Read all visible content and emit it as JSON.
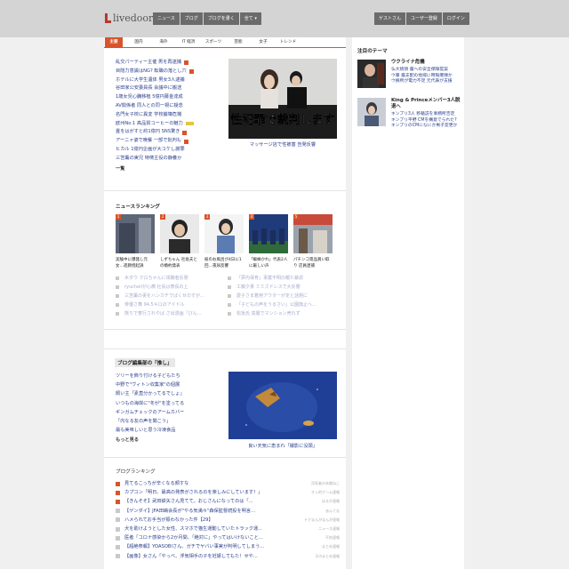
{
  "header": {
    "logo_text": "livedoor",
    "nav": [
      "ニュース",
      "ブログ",
      "ブログを書く",
      "全て ▾"
    ],
    "right": [
      "ゲストさん",
      "ユーザー登録",
      "ログイン"
    ]
  },
  "categories": [
    "主要",
    "国内",
    "海外",
    "IT 経済",
    "スポーツ",
    "芸能",
    "女子",
    "トレンド"
  ],
  "headlines": [
    {
      "text": "乱交パーティー主催 男を再逮捕",
      "badge": "new"
    },
    {
      "text": "目隠力意識はNG? 転職の落とし穴",
      "badge": "new"
    },
    {
      "text": "ホテルに大学生遺体 男女3人逮捕",
      "badge": ""
    },
    {
      "text": "谷田家公安委員長 会議中に搬送",
      "badge": ""
    },
    {
      "text": "1歳女児心臓移植 5億円募金達成",
      "badge": ""
    },
    {
      "text": "AV関係者 同人との同一視に疑念",
      "badge": ""
    },
    {
      "text": "名門女子校に異変 学校崩壊危機",
      "badge": ""
    },
    {
      "text": "欧州No.1 高品質コーヒーの魅力",
      "badge": "img"
    },
    {
      "text": "畳をはがすと約1億円 SNS驚き",
      "badge": "new"
    },
    {
      "text": "アーニャ姿で晩餐 一部で批判も",
      "badge": "new"
    },
    {
      "text": "ヒカル 1億円企画が大コケし謝罪",
      "badge": ""
    },
    {
      "text": "三笘薫の実兄 特徴主役の静養か",
      "badge": ""
    }
  ],
  "headlines_more": "一覧",
  "feature": {
    "overlay_text": "性犯罪で裁判します",
    "caption": "マッサージ店で性被害 告発反響"
  },
  "ranking": {
    "title": "ニュースランキング",
    "top": [
      {
        "num": "1",
        "caption": "実験中に爆発し元女…進教授起訴"
      },
      {
        "num": "2",
        "caption": "しずちゃん 社長夫との婚約発表"
      },
      {
        "num": "3",
        "caption": "彼のお風呂が4日に1回…夜尿反響"
      },
      {
        "num": "4",
        "caption": "「蜘蛛かれ」代表2人に厳しい声"
      },
      {
        "num": "5",
        "caption": "パチンコ景品買い取り 店員逮捕"
      }
    ],
    "list": [
      "木ダウ クロちゃんに視聴者反発",
      "「夢内保育」事業不明の親た暴虐",
      "ryuchellが心療 社長は寮長の上",
      "工藤夕貴 ミミズドレスで大反響",
      "三笘薫の妻をハンカチでばくせのすが…",
      "愛子さま着用アウターが定と話題に",
      "俳優さ舞 94.5キロのアイドル",
      "「子どもの声をうるさい」公園廃止へ…",
      "熊りで寮行されやば さ出漫画「びん…",
      "松坂氏 高層でマンション売れず"
    ]
  },
  "blog_pick": {
    "title": "ブログ編集部の「推し」",
    "items": [
      "ツリーを飾り付ける子どもたち",
      "中野で\"ヴィトン収集家\"の個展",
      "飼い主「素直分かってるでしょ」",
      "いつもの海岸に\"冬が\"を塗ってる",
      "ギンガムチェックのアームカバー",
      "「内なる友の声を聞こう」",
      "最も美味しいと思う冷凍食品"
    ],
    "more": "もっと見る",
    "caption": "良い天気に恵まれ「撮影に没頭」"
  },
  "blog_ranking": {
    "title": "ブログランキング",
    "items": [
      {
        "text": "見てるこっちが辛くなる顔すな",
        "source": "浮気者の末路ねこ",
        "hot": true
      },
      {
        "text": "カプコン「明日、最高の発表がされるのを楽しみにしています！」",
        "source": "オレ的ゲーム速報",
        "hot": true
      },
      {
        "text": "【きんそそ】武田鉄矢さん見てて。おじさんになってのは「...",
        "source": "はるか速報",
        "hot": true
      },
      {
        "text": "【ゲンダイ】JFA田嶋会長が\"やる気満々\"森保監督続投を明言...",
        "source": "あんてな",
        "hot": false
      },
      {
        "text": "ハメられてお手当が振わなかった件【29】",
        "source": "ドクまんがまんが速報",
        "hot": false
      },
      {
        "text": "犬を助けようとした女性、スマホで猫生運動していたトラック運...",
        "source": "ニュース速報",
        "hot": false
      },
      {
        "text": "医者「コロナ感染から2か月間、「絶対に」やってはいけないこと...",
        "source": "不良速報",
        "hot": false
      },
      {
        "text": "【超絶祭報】YOASOBIさん、ガチでヤバい事実が判明してしまう...",
        "source": "まとめ速報",
        "hot": false
      },
      {
        "text": "【画像】女さん「やっべ、浮気相手の子を妊娠してもた！せや...",
        "source": "2chまとめ速報",
        "hot": false
      }
    ]
  },
  "sidebar": {
    "title": "注目のテーマ",
    "themes": [
      {
        "head": "ウクライナ危機",
        "links": [
          "仏大統領 露への安全保障提案",
          "ウ軍 露支配の地域に時限爆弾か",
          "ウ摘所が電力不足 元代表が支援"
        ]
      },
      {
        "head": "King & Princeメンバー3人脱退へ",
        "links": [
          "キンプリ3人 移籍説を事務所否定",
          "キンプリ平野 CMを構意でられた?",
          "キンプリのCMになにか男子変更か"
        ]
      }
    ]
  },
  "colors": {
    "accent": "#d9542b",
    "link": "#2b3f8c",
    "nav_button": "#6b6b6b",
    "header_bg": "#d4d4d4"
  }
}
